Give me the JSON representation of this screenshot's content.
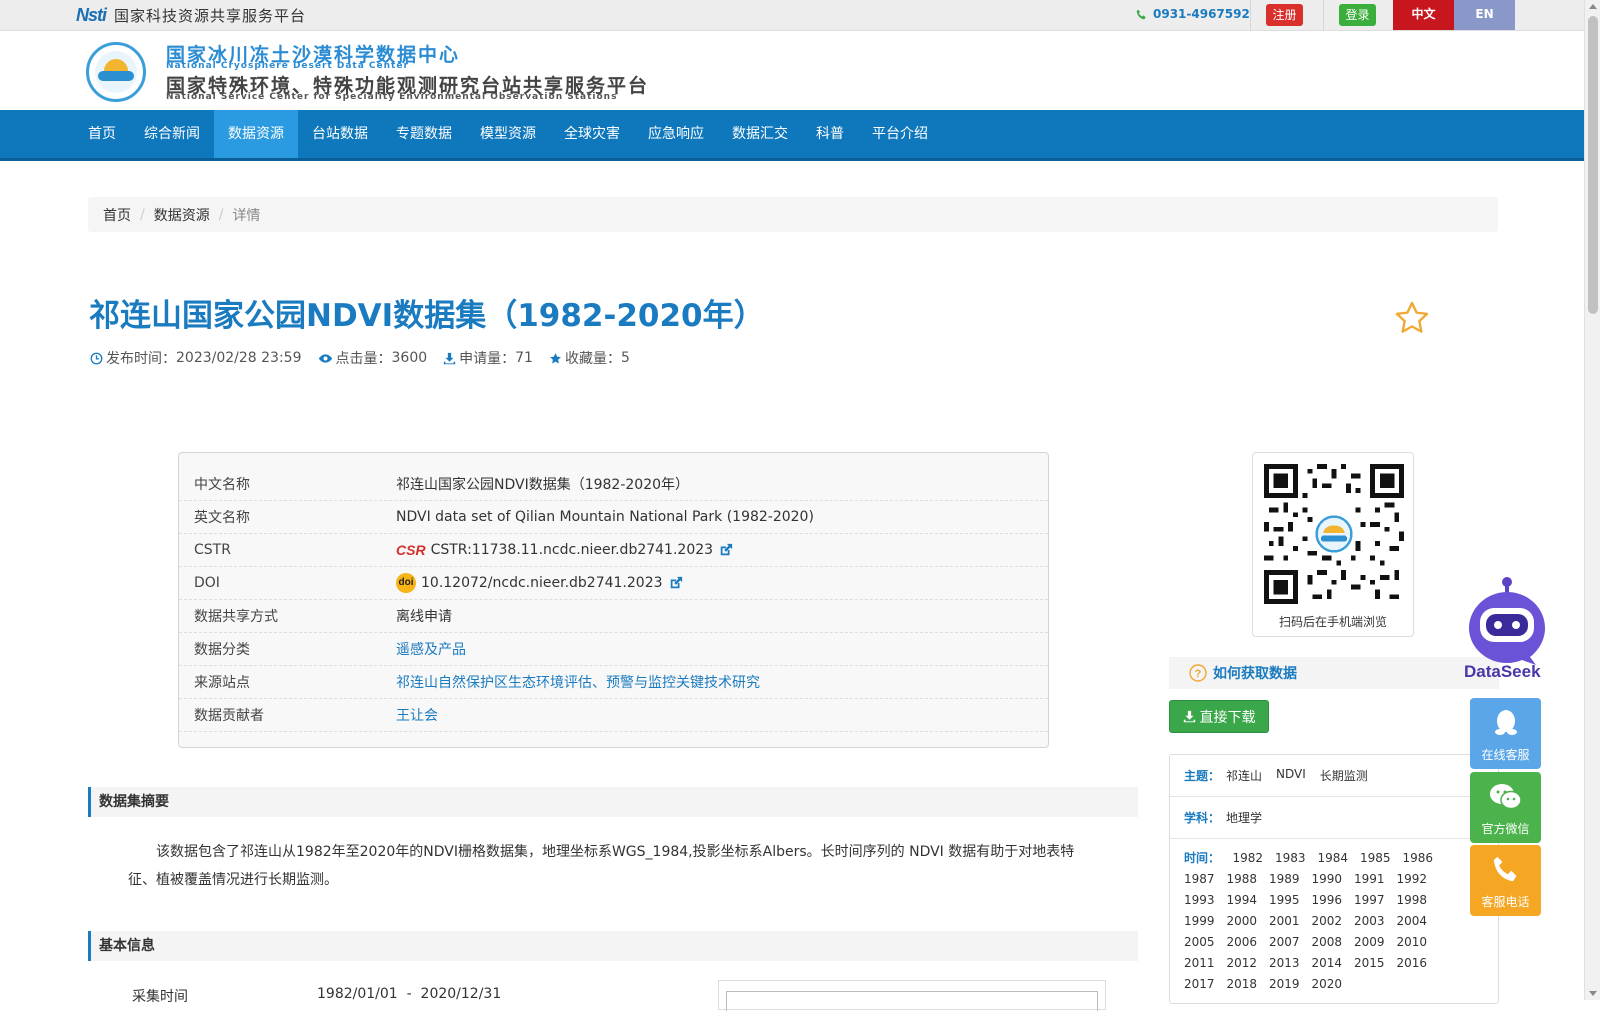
{
  "topbar": {
    "nsti_logo": "Nsti",
    "platform_name": "国家科技资源共享服务平台",
    "phone": "0931-4967592",
    "register": "注册",
    "login": "登录",
    "lang_zh": "中文",
    "lang_en": "EN"
  },
  "header": {
    "title_cn": "国家冰川冻土沙漠科学数据中心",
    "title_en": "National Cryosphere Desert Data Center",
    "subtitle_cn": "国家特殊环境、特殊功能观测研究台站共享服务平台",
    "subtitle_en": "National Service Center for Speciality Environmental Observation Stations"
  },
  "nav": {
    "items": [
      "首页",
      "综合新闻",
      "数据资源",
      "台站数据",
      "专题数据",
      "模型资源",
      "全球灾害",
      "应急响应",
      "数据汇交",
      "科普",
      "平台介绍"
    ],
    "active_index": 2
  },
  "breadcrumb": {
    "home": "首页",
    "section": "数据资源",
    "current": "详情"
  },
  "dataset": {
    "title": "祁连山国家公园NDVI数据集（1982-2020年）",
    "publish_label": "发布时间：",
    "publish_time": "2023/02/28 23:59",
    "clicks_label": "点击量：",
    "clicks": "3600",
    "applies_label": "申请量：",
    "applies": "71",
    "favorites_label": "收藏量：",
    "favorites": "5"
  },
  "info": {
    "rows": [
      {
        "key": "中文名称",
        "value": "祁连山国家公园NDVI数据集（1982-2020年）"
      },
      {
        "key": "英文名称",
        "value": "NDVI data set of Qilian Mountain National Park (1982-2020)"
      },
      {
        "key": "CSTR",
        "value": "CSTR:11738.11.ncdc.nieer.db2741.2023"
      },
      {
        "key": "DOI",
        "value": "10.12072/ncdc.nieer.db2741.2023"
      },
      {
        "key": "数据共享方式",
        "value": "离线申请"
      },
      {
        "key": "数据分类",
        "value": "遥感及产品"
      },
      {
        "key": "来源站点",
        "value": "祁连山自然保护区生态环境评估、预警与监控关键技术研究"
      },
      {
        "key": "数据贡献者",
        "value": "王让会"
      }
    ],
    "cstr_badge": "CSR",
    "doi_badge": "doi"
  },
  "sections": {
    "abstract_title": "数据集摘要",
    "abstract_text": "该数据包含了祁连山从1982年至2020年的NDVI栅格数据集，地理坐标系WGS_1984,投影坐标系Albers。长时间序列的 NDVI 数据有助于对地表特征、植被覆盖情况进行长期监测。",
    "basic_title": "基本信息",
    "collect_label": "采集时间",
    "collect_value": "1982/01/01  -  2020/12/31"
  },
  "sidebar": {
    "qr_caption": "扫码后在手机端浏览",
    "howto": "如何获取数据",
    "download": "直接下载",
    "theme_label": "主题：",
    "themes": [
      "祁连山",
      "NDVI",
      "长期监测"
    ],
    "discipline_label": "学科：",
    "discipline": "地理学",
    "time_label": "时间：",
    "years": [
      "1982",
      "1983",
      "1984",
      "1985",
      "1986",
      "1987",
      "1988",
      "1989",
      "1990",
      "1991",
      "1992",
      "1993",
      "1994",
      "1995",
      "1996",
      "1997",
      "1998",
      "1999",
      "2000",
      "2001",
      "2002",
      "2003",
      "2004",
      "2005",
      "2006",
      "2007",
      "2008",
      "2009",
      "2010",
      "2011",
      "2012",
      "2013",
      "2014",
      "2015",
      "2016",
      "2017",
      "2018",
      "2019",
      "2020"
    ]
  },
  "floating": {
    "dataseek": "DataSeek",
    "online_service": "在线客服",
    "wechat": "官方微信",
    "phone_service": "客服电话"
  },
  "colors": {
    "brand_blue": "#1a7bc0",
    "nav_blue": "#0f78bd",
    "green": "#3aa84a",
    "red": "#c8161e",
    "float_blue": "#5aa6e8",
    "float_green": "#4cb34c",
    "float_orange": "#f5a623"
  }
}
